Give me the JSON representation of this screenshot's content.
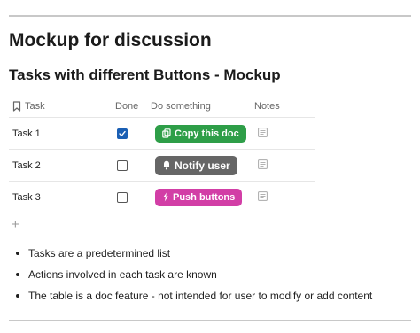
{
  "heading": "Mockup for discussion",
  "subheading": "Tasks with different Buttons - Mockup",
  "table": {
    "columns": {
      "task": "Task",
      "done": "Done",
      "action": "Do something",
      "notes": "Notes"
    },
    "rows": [
      {
        "task": "Task 1",
        "done": true,
        "button": {
          "label": "Copy this doc",
          "icon": "copy-icon",
          "color": "#2e9e48"
        }
      },
      {
        "task": "Task 2",
        "done": false,
        "button": {
          "label": "Notify user",
          "icon": "bell-icon",
          "color": "#666666"
        }
      },
      {
        "task": "Task 3",
        "done": false,
        "button": {
          "label": "Push buttons",
          "icon": "lightning-icon",
          "color": "#d23ea6"
        }
      }
    ],
    "add_row_label": "+"
  },
  "bullets": [
    "Tasks are a predetermined list",
    "Actions involved in each task are known",
    "The table is a doc feature - not intended for user to modify or add content"
  ],
  "colors": {
    "checkbox_checked": "#1a5fb4",
    "rule": "#c8c8c8"
  }
}
